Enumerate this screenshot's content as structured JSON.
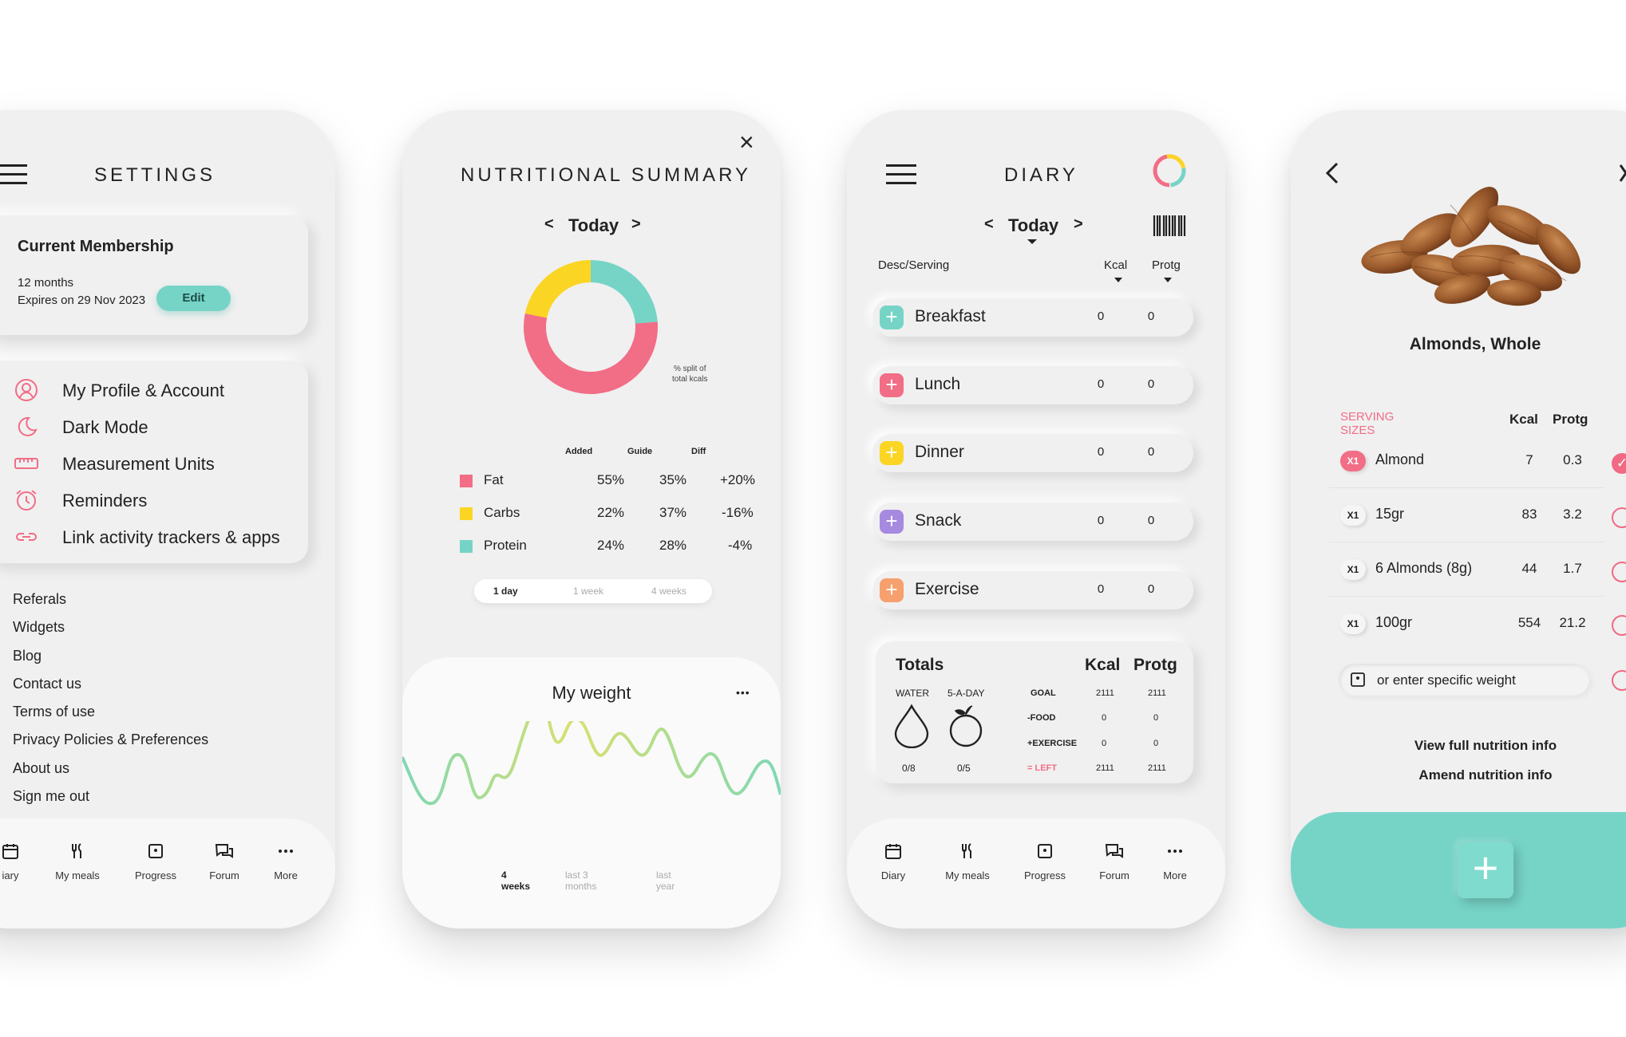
{
  "colors": {
    "accent": "#76d4c7",
    "pink": "#f26d86",
    "yellow": "#fbd524",
    "purple": "#a68ae0",
    "orange": "#f6a06e",
    "teal": "#76d4c7"
  },
  "settings": {
    "title": "SETTINGS",
    "membership": {
      "heading": "Current Membership",
      "duration": "12 months",
      "expires": "Expires on 29 Nov 2023",
      "edit_label": "Edit"
    },
    "menu": [
      {
        "label": "My Profile & Account",
        "icon": "user-circle-icon"
      },
      {
        "label": "Dark Mode",
        "icon": "moon-icon"
      },
      {
        "label": "Measurement Units",
        "icon": "ruler-icon"
      },
      {
        "label": "Reminders",
        "icon": "alarm-clock-icon"
      },
      {
        "label": "Link activity trackers & apps",
        "icon": "link-icon"
      }
    ],
    "links": [
      "Referals",
      "Widgets",
      "Blog",
      "Contact us",
      "Terms of use",
      "Privacy Policies & Preferences",
      "About us",
      "Sign me out"
    ]
  },
  "nav": {
    "diary_partial": "iary",
    "diary": "Diary",
    "meals": "My meals",
    "progress": "Progress",
    "forum": "Forum",
    "more": "More"
  },
  "summary": {
    "title": "NUTRITIONAL SUMMARY",
    "date": "Today",
    "prev": "<",
    "next": ">",
    "close": "×",
    "donut_note_1": "% split of",
    "donut_note_2": "total kcals",
    "headers": {
      "added": "Added",
      "guide": "Guide",
      "diff": "Diff"
    },
    "rows": [
      {
        "name": "Fat",
        "added": "55%",
        "guide": "35%",
        "diff": "+20%"
      },
      {
        "name": "Carbs",
        "added": "22%",
        "guide": "37%",
        "diff": "-16%"
      },
      {
        "name": "Protein",
        "added": "24%",
        "guide": "28%",
        "diff": "-4%"
      }
    ],
    "periods": [
      "1 day",
      "1 week",
      "4 weeks"
    ],
    "weight": {
      "title": "My weight",
      "more": "•••",
      "ranges": [
        "4 weeks",
        "last 3 months",
        "last year"
      ]
    }
  },
  "chart_data": {
    "type": "pie",
    "labels": [
      "Fat",
      "Carbs",
      "Protein"
    ],
    "values": [
      55,
      22,
      24
    ],
    "colors": [
      "#f26d86",
      "#fbd524",
      "#76d4c7"
    ]
  },
  "diary": {
    "title": "DIARY",
    "date": "Today",
    "prev": "<",
    "next": ">",
    "col_desc": "Desc/Serving",
    "col_kcal": "Kcal",
    "col_prot": "Protg",
    "meals": [
      {
        "name": "Breakfast",
        "kcal": "0",
        "prot": "0",
        "color": "#76d4c7"
      },
      {
        "name": "Lunch",
        "kcal": "0",
        "prot": "0",
        "color": "#f26d86"
      },
      {
        "name": "Dinner",
        "kcal": "0",
        "prot": "0",
        "color": "#fbd524"
      },
      {
        "name": "Snack",
        "kcal": "0",
        "prot": "0",
        "color": "#a68ae0"
      },
      {
        "name": "Exercise",
        "kcal": "0",
        "prot": "0",
        "color": "#f6a06e"
      }
    ],
    "totals": {
      "heading": "Totals",
      "kcal": "Kcal",
      "prot": "Protg",
      "water": "WATER",
      "five_a_day": "5-A-DAY",
      "water_val": "0/8",
      "fruit_val": "0/5",
      "rows": [
        {
          "label": "GOAL",
          "kcal": "2111",
          "prot": "2111"
        },
        {
          "label": "-FOOD",
          "kcal": "0",
          "prot": "0"
        },
        {
          "label": "+EXERCISE",
          "kcal": "0",
          "prot": "0"
        },
        {
          "label": "= LEFT",
          "kcal": "2111",
          "prot": "2111"
        }
      ]
    }
  },
  "food": {
    "name": "Almonds, Whole",
    "section": "SERVING SIZES",
    "col_kcal": "Kcal",
    "col_prot": "Protg",
    "servings": [
      {
        "qty": "X1",
        "label": "Almond",
        "kcal": "7",
        "prot": "0.3"
      },
      {
        "qty": "X1",
        "label": "15gr",
        "kcal": "83",
        "prot": "3.2"
      },
      {
        "qty": "X1",
        "label": "6 Almonds (8g)",
        "kcal": "44",
        "prot": "1.7"
      },
      {
        "qty": "X1",
        "label": "100gr",
        "kcal": "554",
        "prot": "21.2"
      }
    ],
    "weight_placeholder": "or enter specific weight",
    "view_full": "View full nutrition info",
    "amend": "Amend nutrition info",
    "add": "+"
  }
}
